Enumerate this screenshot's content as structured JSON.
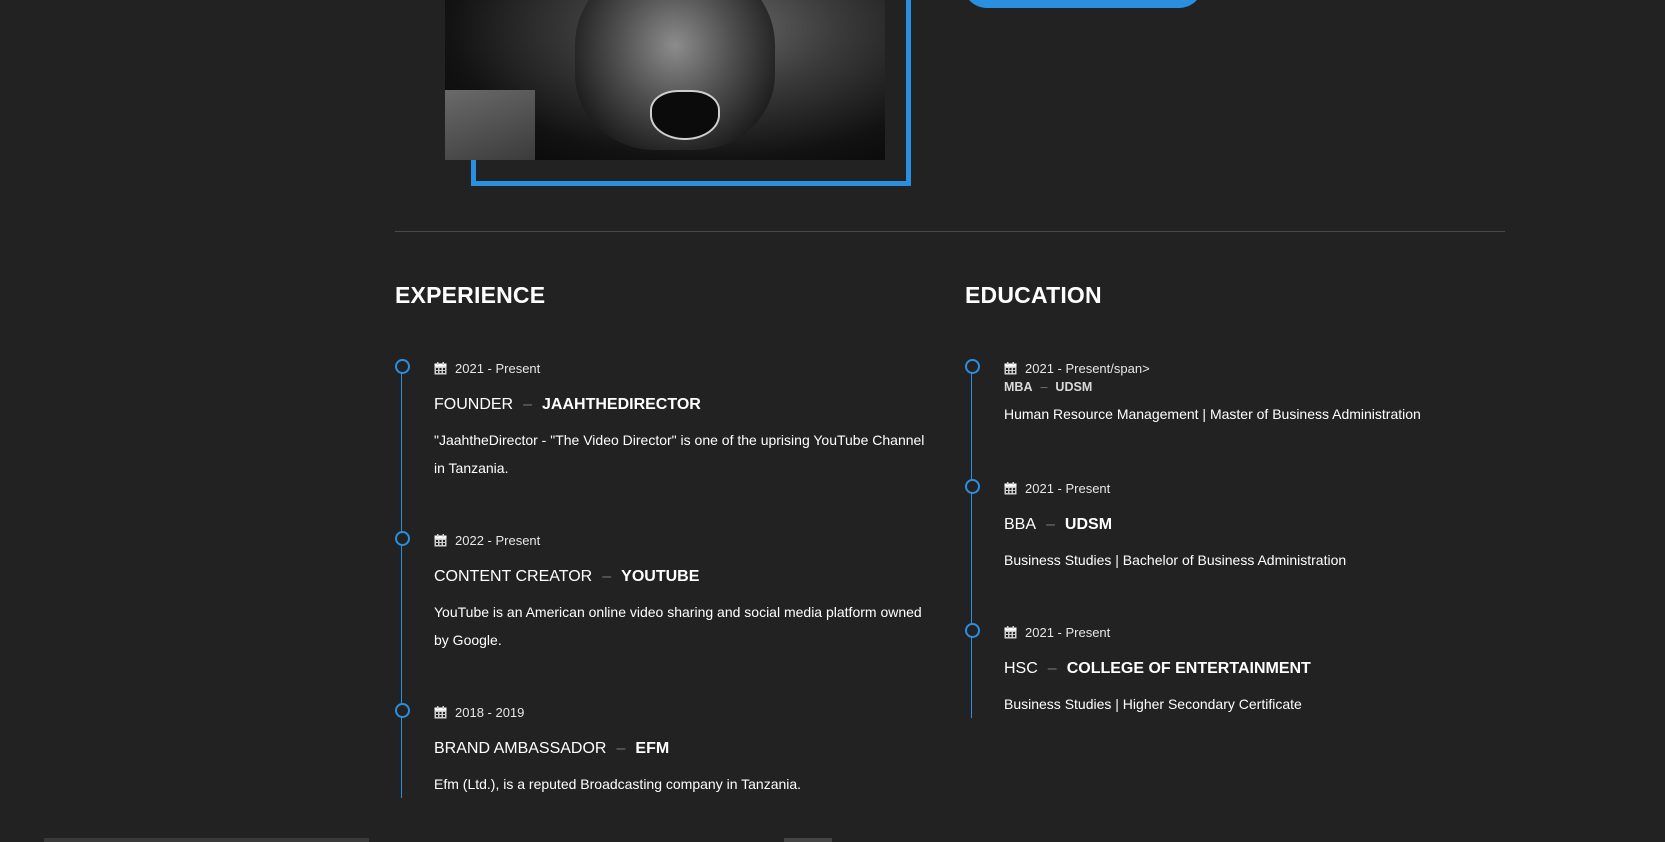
{
  "cta": {
    "label": ""
  },
  "experience": {
    "title": "EXPERIENCE",
    "items": [
      {
        "date": "2021 - Present",
        "role": "FOUNDER",
        "org": "JAAHTHEDIRECTOR",
        "desc": "\"JaahtheDirector - \"The Video Director\" is one of the uprising YouTube Channel in Tanzania."
      },
      {
        "date": "2022 - Present",
        "role": "CONTENT CREATOR",
        "org": "YOUTUBE",
        "desc": "YouTube is an American online video sharing and social media platform owned by Google."
      },
      {
        "date": "2018 - 2019",
        "role": "BRAND AMBASSADOR",
        "org": "EFM",
        "desc": "Efm (Ltd.), is a reputed Broadcasting company in Tanzania."
      }
    ]
  },
  "education": {
    "title": "EDUCATION",
    "items": [
      {
        "date": "2021 - Present/span>",
        "degree": "MBA",
        "school": "UDSM",
        "desc": "Human Resource Management | Master of Business Administration"
      },
      {
        "date": "2021 - Present",
        "degree": "BBA",
        "school": "UDSM",
        "desc": "Business Studies | Bachelor of Business Administration"
      },
      {
        "date": "2021 - Present",
        "degree": "HSC",
        "school": "COLLEGE OF ENTERTAINMENT",
        "desc": "Business Studies | Higher Secondary Certificate"
      }
    ]
  },
  "separator": "–",
  "icons": {
    "date": "calendar-icon"
  },
  "colors": {
    "accent": "#2b8fe0",
    "background": "#222222",
    "text": "#ffffff"
  }
}
